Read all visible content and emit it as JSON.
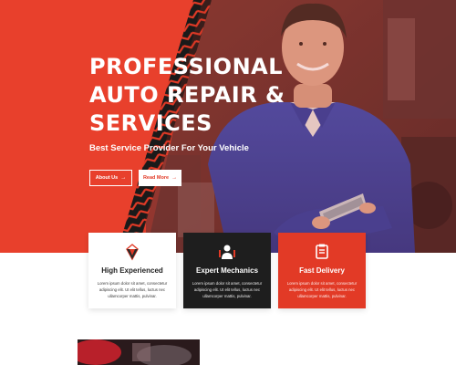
{
  "hero": {
    "title_lines": [
      "PROFESSIONAL",
      "AUTO REPAIR &",
      "SERVICES"
    ],
    "subtitle": "Best Service Provider For Your Vehicle",
    "buttons": [
      {
        "label": "About Us",
        "icon": "arrow-right-icon"
      },
      {
        "label": "Read More",
        "icon": "arrow-right-icon"
      }
    ]
  },
  "features": [
    {
      "title": "High Experienced",
      "text": "Lorem ipsum dolor sit amet, consectetur adipiscing elit. Ut elit tellus, luctus nec ullamcorper mattis, pulvinar.",
      "icon": "diamond-badge-icon",
      "theme": "light"
    },
    {
      "title": "Expert Mechanics",
      "text": "Lorem ipsum dolor sit amet, consectetur adipiscing elit. Ut elit tellus, luctus nec ullamcorper mattis, pulvinar.",
      "icon": "mechanic-tools-icon",
      "theme": "dark"
    },
    {
      "title": "Fast Delivery",
      "text": "Lorem ipsum dolor sit amet, consectetur adipiscing elit. Ut elit tellus, luctus nec ullamcorper mattis, pulvinar.",
      "icon": "delivery-truck-icon",
      "theme": "red"
    }
  ],
  "colors": {
    "brand_red": "#e23a26",
    "dark": "#1e1e1e",
    "white": "#ffffff"
  }
}
